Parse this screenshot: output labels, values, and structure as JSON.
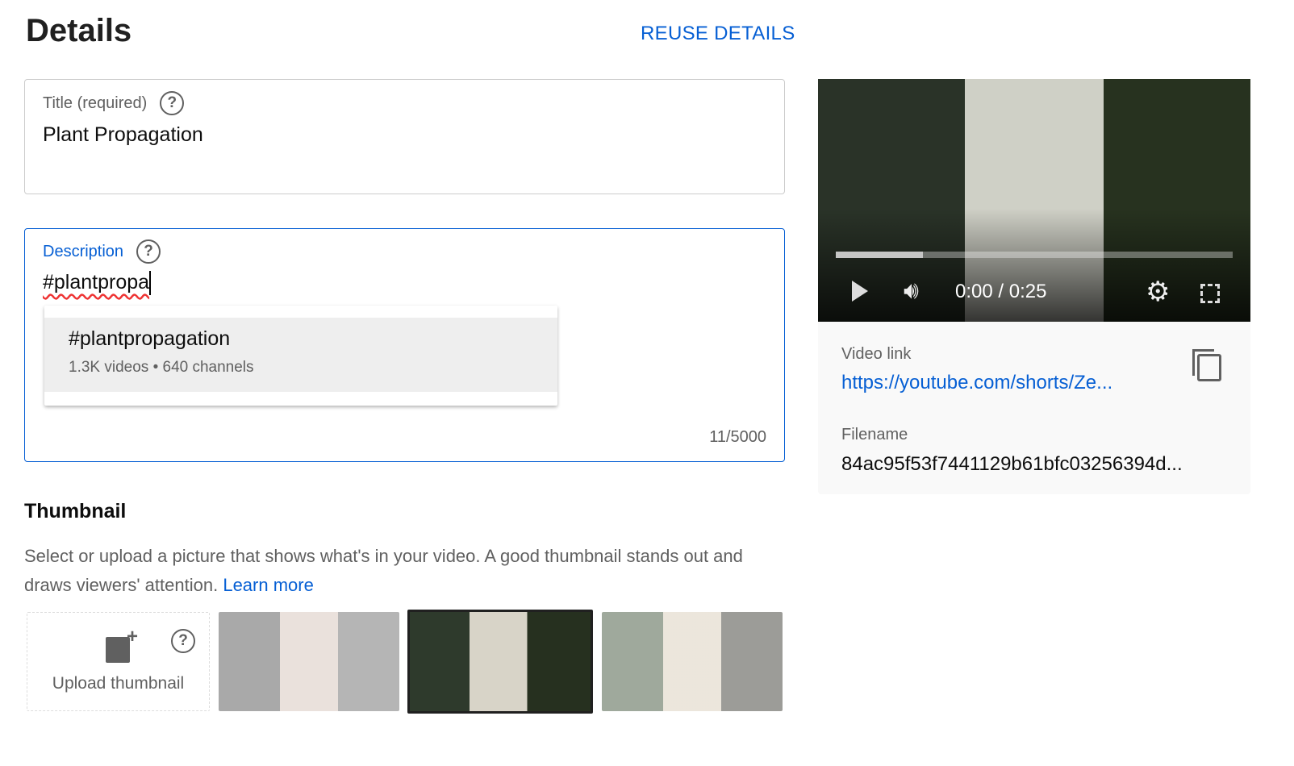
{
  "header": {
    "title": "Details",
    "reuse_label": "REUSE DETAILS"
  },
  "title_field": {
    "label": "Title (required)",
    "value": "Plant Propagation"
  },
  "description_field": {
    "label": "Description",
    "value": "#plantpropa",
    "counter": "11/5000",
    "suggestion": {
      "tag": "#plantpropagation",
      "meta": "1.3K videos • 640 channels"
    }
  },
  "thumbnail": {
    "heading": "Thumbnail",
    "description": "Select or upload a picture that shows what's in your video. A good thumbnail stands out and draws viewers' attention.",
    "learn_more": "Learn more",
    "upload_label": "Upload thumbnail",
    "selected_index": 1
  },
  "player": {
    "time": "0:00 / 0:25",
    "progress_percent": 22
  },
  "info": {
    "video_link_label": "Video link",
    "video_link": "https://youtube.com/shorts/Ze...",
    "filename_label": "Filename",
    "filename": "84ac95f53f7441129b61bfc03256394d..."
  },
  "colors": {
    "accent": "#065fd4",
    "secondary_text": "#606060"
  }
}
